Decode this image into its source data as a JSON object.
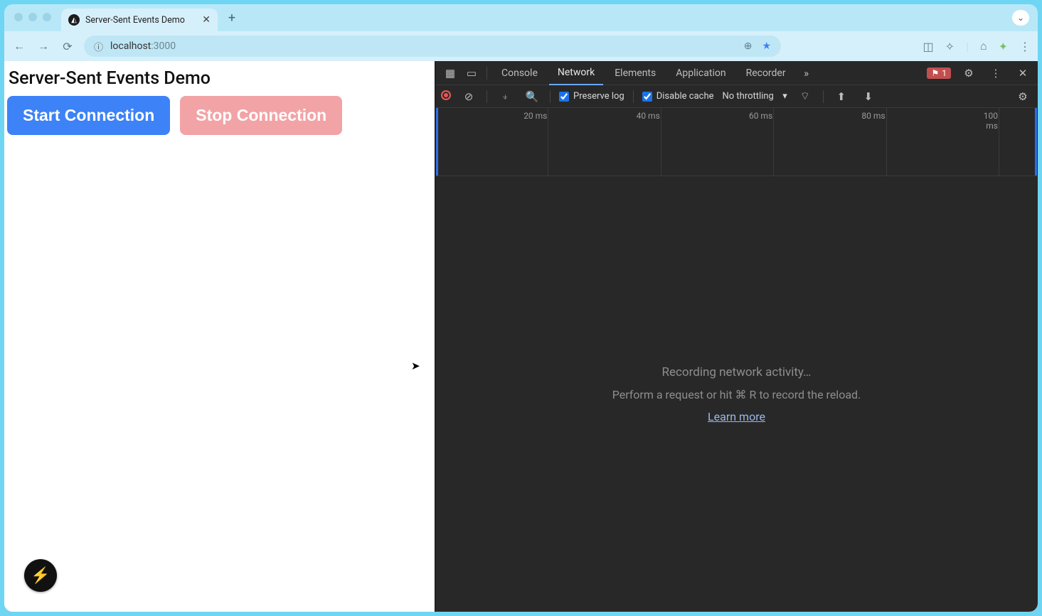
{
  "browser": {
    "tab_title": "Server-Sent Events Demo",
    "url_host": "localhost",
    "url_port": ":3000"
  },
  "page": {
    "heading": "Server-Sent Events Demo",
    "start_btn": "Start Connection",
    "stop_btn": "Stop Connection"
  },
  "devtools": {
    "tabs": {
      "console": "Console",
      "network": "Network",
      "elements": "Elements",
      "application": "Application",
      "recorder": "Recorder"
    },
    "issues_count": "1",
    "preserve_log": "Preserve log",
    "disable_cache": "Disable cache",
    "throttling": "No throttling",
    "ruler": {
      "t1": "20 ms",
      "t2": "40 ms",
      "t3": "60 ms",
      "t4": "80 ms",
      "t5": "100 ms"
    },
    "empty": {
      "line1": "Recording network activity…",
      "line2": "Perform a request or hit ⌘ R to record the reload.",
      "learn_more": "Learn more"
    }
  }
}
